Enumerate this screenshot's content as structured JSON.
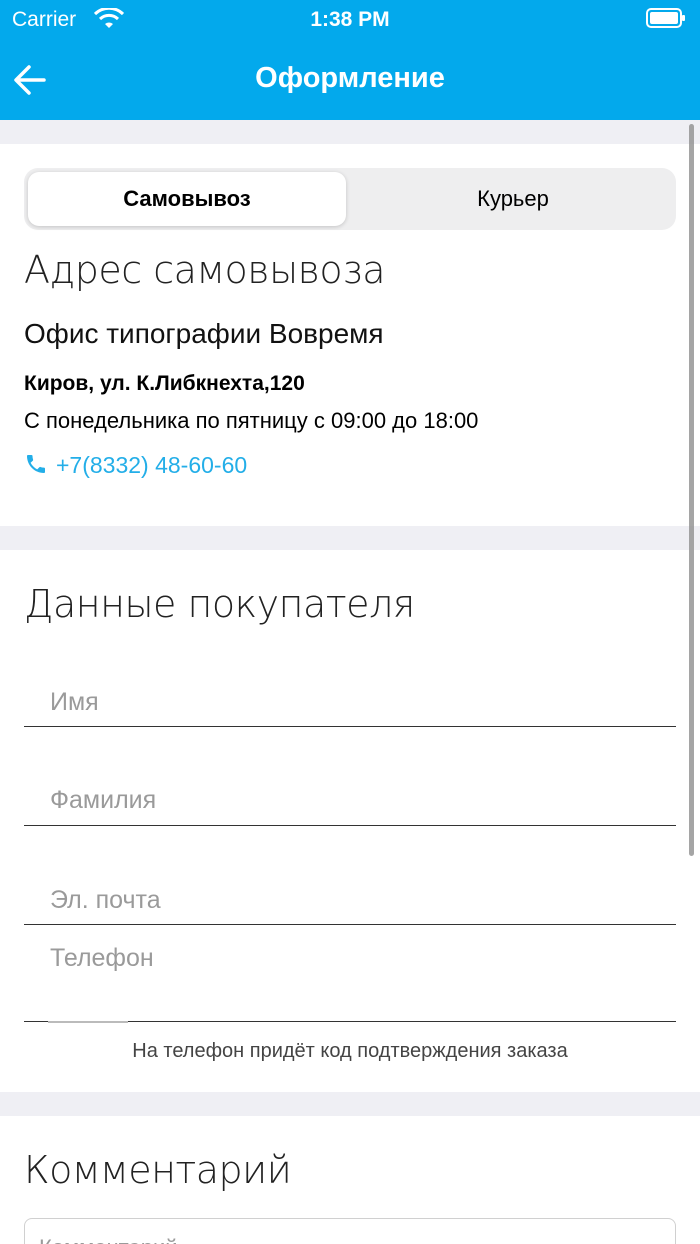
{
  "status_bar": {
    "carrier": "Carrier",
    "time": "1:38 PM"
  },
  "nav": {
    "title": "Оформление"
  },
  "delivery": {
    "tabs": [
      {
        "label": "Самовывоз",
        "active": true
      },
      {
        "label": "Курьер",
        "active": false
      }
    ]
  },
  "pickup": {
    "heading": "Адрес самовывоза",
    "office": "Офис типографии Вовремя",
    "street": "Киров, ул. К.Либкнехта,120",
    "hours": "С понедельника по пятницу с 09:00 до 18:00",
    "phone": "+7(8332) 48-60-60"
  },
  "buyer": {
    "heading": "Данные покупателя",
    "fields": [
      {
        "placeholder": "Имя"
      },
      {
        "placeholder": "Фамилия"
      },
      {
        "placeholder": "Эл. почта"
      },
      {
        "placeholder": "Телефон"
      }
    ],
    "phone_hint": "На телефон придёт код подтверждения заказа"
  },
  "comment": {
    "heading": "Комментарий",
    "placeholder": "Комментарий"
  },
  "colors": {
    "header": "#03a9ec",
    "link": "#23aee8",
    "background": "#efeff4"
  }
}
